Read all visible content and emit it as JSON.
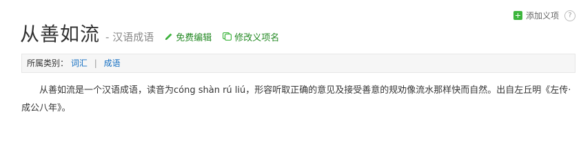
{
  "header": {
    "title": "从善如流",
    "subtitle": "- 汉语成语",
    "edit_label": "免费编辑",
    "rename_label": "修改义项名",
    "add_sense_label": "添加义项",
    "help_glyph": "?"
  },
  "category": {
    "label": "所属类别：",
    "items": [
      "词汇",
      "成语"
    ],
    "separator": "|"
  },
  "summary": {
    "text": "从善如流是一个汉语成语，读音为cóng shàn rú liú，形容听取正确的意见及接受善意的规劝像流水那样快而自然。出自左丘明《左传·成公八年》。"
  },
  "colors": {
    "accent_green": "#228822",
    "link_blue": "#136ec2",
    "plus_green": "#3db53d"
  }
}
